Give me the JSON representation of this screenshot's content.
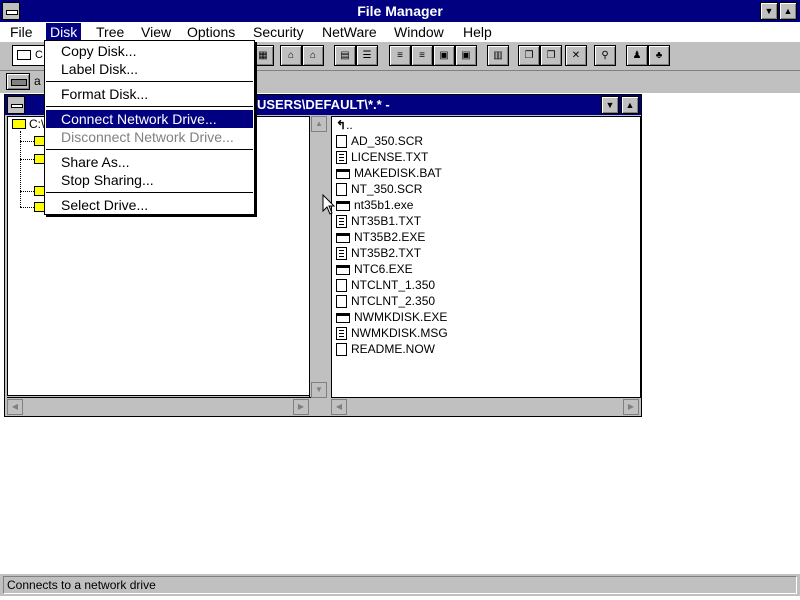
{
  "app": {
    "title": "File Manager"
  },
  "menubar": {
    "items": [
      "File",
      "Disk",
      "Tree",
      "View",
      "Options",
      "Security",
      "NetWare",
      "Window",
      "Help"
    ]
  },
  "toolbar": {
    "drive_combo_text": "C"
  },
  "drivebar": {
    "label": "a"
  },
  "child_window": {
    "title": "USERS\\DEFAULT\\*.* -"
  },
  "tree": {
    "root_label": "C:\\"
  },
  "file_list": {
    "up_label": "..",
    "files": [
      {
        "name": "AD_350.SCR",
        "type": "doc"
      },
      {
        "name": "LICENSE.TXT",
        "type": "txt"
      },
      {
        "name": "MAKEDISK.BAT",
        "type": "exe"
      },
      {
        "name": "NT_350.SCR",
        "type": "doc"
      },
      {
        "name": "nt35b1.exe",
        "type": "exe"
      },
      {
        "name": "NT35B1.TXT",
        "type": "txt"
      },
      {
        "name": "NT35B2.EXE",
        "type": "exe"
      },
      {
        "name": "NT35B2.TXT",
        "type": "txt"
      },
      {
        "name": "NTC6.EXE",
        "type": "exe"
      },
      {
        "name": "NTCLNT_1.350",
        "type": "doc"
      },
      {
        "name": "NTCLNT_2.350",
        "type": "doc"
      },
      {
        "name": "NWMKDISK.EXE",
        "type": "exe"
      },
      {
        "name": "NWMKDISK.MSG",
        "type": "txt"
      },
      {
        "name": "README.NOW",
        "type": "doc"
      }
    ]
  },
  "disk_menu": {
    "copy_disk": "Copy Disk...",
    "label_disk": "Label Disk...",
    "format_disk": "Format Disk...",
    "connect_network_drive": "Connect Network Drive...",
    "disconnect_network_drive": "Disconnect Network Drive...",
    "share_as": "Share As...",
    "stop_sharing": "Stop Sharing...",
    "select_drive": "Select Drive..."
  },
  "statusbar": {
    "text": "Connects to a network drive"
  }
}
